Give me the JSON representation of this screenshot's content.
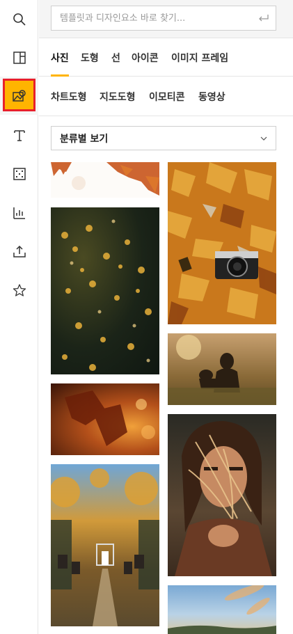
{
  "search": {
    "placeholder": "템플릿과 디자인요소 바로 찾기..."
  },
  "tabs_row1": [
    {
      "label": "사진",
      "active": true
    },
    {
      "label": "도형",
      "active": false
    },
    {
      "label": "선",
      "active": false
    },
    {
      "label": "아이콘",
      "active": false
    },
    {
      "label": "이미지 프레임",
      "active": false
    }
  ],
  "tabs_row2": [
    {
      "label": "차트도형"
    },
    {
      "label": "지도도형"
    },
    {
      "label": "이모티콘"
    },
    {
      "label": "동영상"
    }
  ],
  "dropdown": {
    "selected": "분류별 보기"
  },
  "rail": [
    {
      "icon": "search-icon"
    },
    {
      "icon": "layout-icon"
    },
    {
      "icon": "photo-icon",
      "active": true
    },
    {
      "icon": "text-icon"
    },
    {
      "icon": "pattern-icon"
    },
    {
      "icon": "chart-icon"
    },
    {
      "icon": "upload-icon"
    },
    {
      "icon": "star-icon"
    }
  ],
  "colors": {
    "accent": "#ffb400",
    "highlight_border": "#e8202a"
  }
}
